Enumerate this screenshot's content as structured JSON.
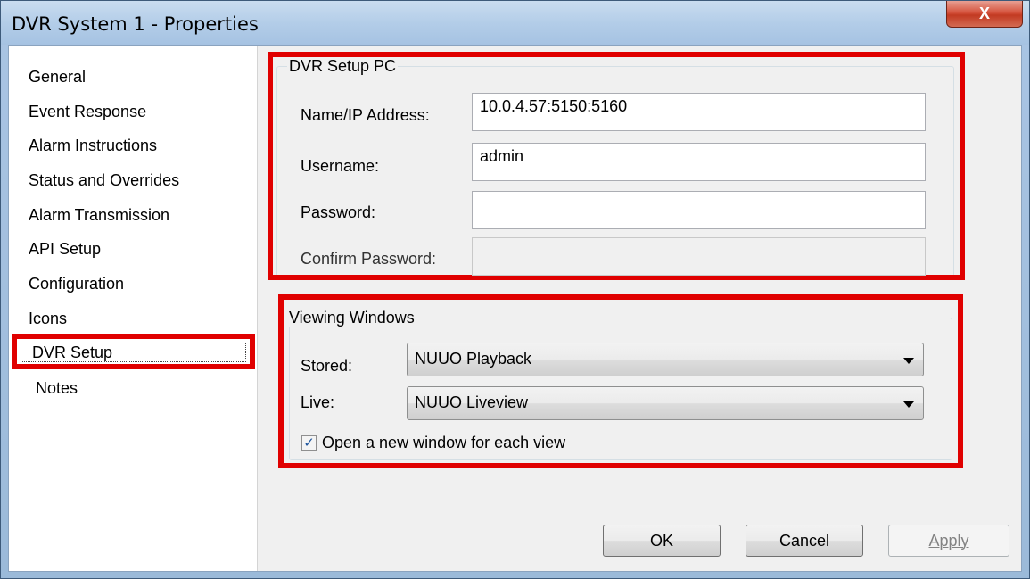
{
  "window": {
    "title": "DVR System 1 - Properties",
    "close_icon": "close-icon",
    "close_glyph": "X"
  },
  "sidebar": {
    "items": [
      {
        "label": "General"
      },
      {
        "label": "Event Response"
      },
      {
        "label": "Alarm Instructions"
      },
      {
        "label": "Status and Overrides"
      },
      {
        "label": "Alarm Transmission"
      },
      {
        "label": "API Setup"
      },
      {
        "label": "Configuration"
      },
      {
        "label": "Icons"
      },
      {
        "label": "DVR Setup",
        "selected": true
      },
      {
        "label": "Notes"
      }
    ]
  },
  "dvr_setup_pc": {
    "title": "DVR Setup PC",
    "name_label": "Name/IP Address:",
    "name_value": "10.0.4.57:5150:5160",
    "username_label": "Username:",
    "username_value": "admin",
    "password_label": "Password:",
    "password_value": "",
    "confirm_label": "Confirm Password:",
    "confirm_value": ""
  },
  "viewing_windows": {
    "title": "Viewing Windows",
    "stored_label": "Stored:",
    "stored_value": "NUUO Playback",
    "live_label": "Live:",
    "live_value": "NUUO Liveview",
    "checkbox_label": "Open a new window for each view",
    "checkbox_checked": true,
    "check_glyph": "✓"
  },
  "buttons": {
    "ok": "OK",
    "cancel": "Cancel",
    "apply": "Apply"
  },
  "colors": {
    "highlight": "#e00000"
  }
}
